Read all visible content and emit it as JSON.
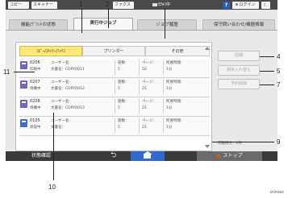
{
  "topbar": {
    "copy": "コピー",
    "scanner": "スキャナー",
    "fax": "ファクス",
    "printing": "印刷中",
    "help": "?",
    "login": "ログイン",
    "moon": "☾"
  },
  "tabs": [
    {
      "label": "機能/ﾌﾟﾘﾝﾄの状態"
    },
    {
      "label": "実行中ジョブ"
    },
    {
      "label": "ジョブ履歴"
    },
    {
      "label": "保守問い合わせ/機器情報"
    }
  ],
  "subtabs": [
    {
      "label": "ｺﾋﾟｰ/ｽｷｬﾅｰ/ﾌｧｸｽ"
    },
    {
      "label": "プリンター"
    },
    {
      "label": "その他"
    }
  ],
  "columns": {
    "code": "ユーザー名：",
    "doc": "文書名：",
    "sets": "部数：",
    "pages": "ページ：",
    "time": "所要時間："
  },
  "jobs": [
    {
      "id": "0206",
      "status": "印刷中",
      "doc": "CDPYO011",
      "sets": "1",
      "pages": "50",
      "time": "1分",
      "icon": "printer-job-icon"
    },
    {
      "id": "0207",
      "status": "待機中",
      "doc": "CDPYO012",
      "sets": "1",
      "pages": "25",
      "time": "1分",
      "icon": "printer-job-icon"
    },
    {
      "id": "0208",
      "status": "待機中",
      "doc": "CDPYO013",
      "sets": "1",
      "pages": "25",
      "time": "1分",
      "icon": "printer-job-icon"
    },
    {
      "id": "0105",
      "status": "保留中",
      "doc": "",
      "sets": "1",
      "pages": "25",
      "time": "1分",
      "icon": "scan-job-icon"
    }
  ],
  "side_buttons": {
    "details": "詳細",
    "reorder": "順序入れ替え",
    "delete": "予約削除"
  },
  "count": "印刷待ち：4件",
  "bottombar": {
    "status": "状態確認",
    "back": "⮌",
    "stop": "ストップ"
  },
  "callouts": [
    "1",
    "2",
    "3",
    "4",
    "5",
    "7",
    "9",
    "10",
    "11"
  ],
  "watermark": "DVK522"
}
